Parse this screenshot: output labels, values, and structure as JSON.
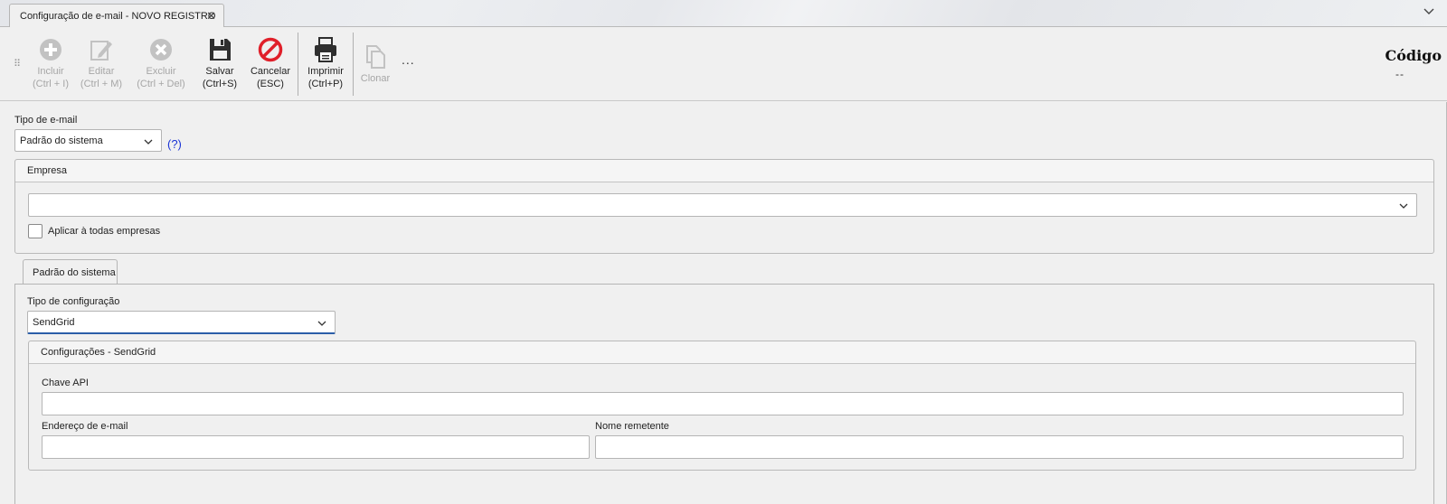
{
  "window": {
    "tab_title": "Configuração de e-mail - NOVO REGISTRO",
    "close_glyph": "✕"
  },
  "toolbar": {
    "grip": "⠿",
    "buttons": [
      {
        "icon": "add-icon",
        "line1": "Incluir",
        "line2": "(Ctrl + I)",
        "enabled": false
      },
      {
        "icon": "edit-icon",
        "line1": "Editar",
        "line2": "(Ctrl + M)",
        "enabled": false
      },
      {
        "icon": "delete-icon",
        "line1": "Excluir",
        "line2": "(Ctrl + Del)",
        "enabled": false
      },
      {
        "icon": "save-icon",
        "line1": "Salvar",
        "line2": "(Ctrl+S)",
        "enabled": true
      },
      {
        "icon": "cancel-icon",
        "line1": "Cancelar",
        "line2": "(ESC)",
        "enabled": true
      },
      {
        "icon": "print-icon",
        "line1": "Imprimir",
        "line2": "(Ctrl+P)",
        "enabled": true
      },
      {
        "icon": "clone-icon",
        "line1": "Clonar",
        "line2": "",
        "enabled": false
      }
    ],
    "more": "...",
    "codigo_label": "Código",
    "codigo_value": "--"
  },
  "form": {
    "tipo_email_label": "Tipo de e-mail",
    "tipo_email_value": "Padrão do sistema",
    "help": "(?)",
    "empresa": {
      "title": "Empresa",
      "value": "",
      "apply_all_label": "Aplicar à todas empresas",
      "apply_all_checked": false
    },
    "tabs": [
      {
        "label": "Padrão do sistema",
        "active": true
      }
    ],
    "tipo_config_label": "Tipo de configuração",
    "tipo_config_value": "SendGrid",
    "sendgrid": {
      "title": "Configurações - SendGrid",
      "api_key_label": "Chave API",
      "api_key_value": "",
      "email_label": "Endereço de e-mail",
      "email_value": "",
      "sender_label": "Nome remetente",
      "sender_value": ""
    }
  },
  "colors": {
    "accent_blue": "#2b5ea8",
    "help_blue": "#1a34d6",
    "cancel_red": "#e0202a",
    "disabled_gray": "#a6a6a6"
  }
}
